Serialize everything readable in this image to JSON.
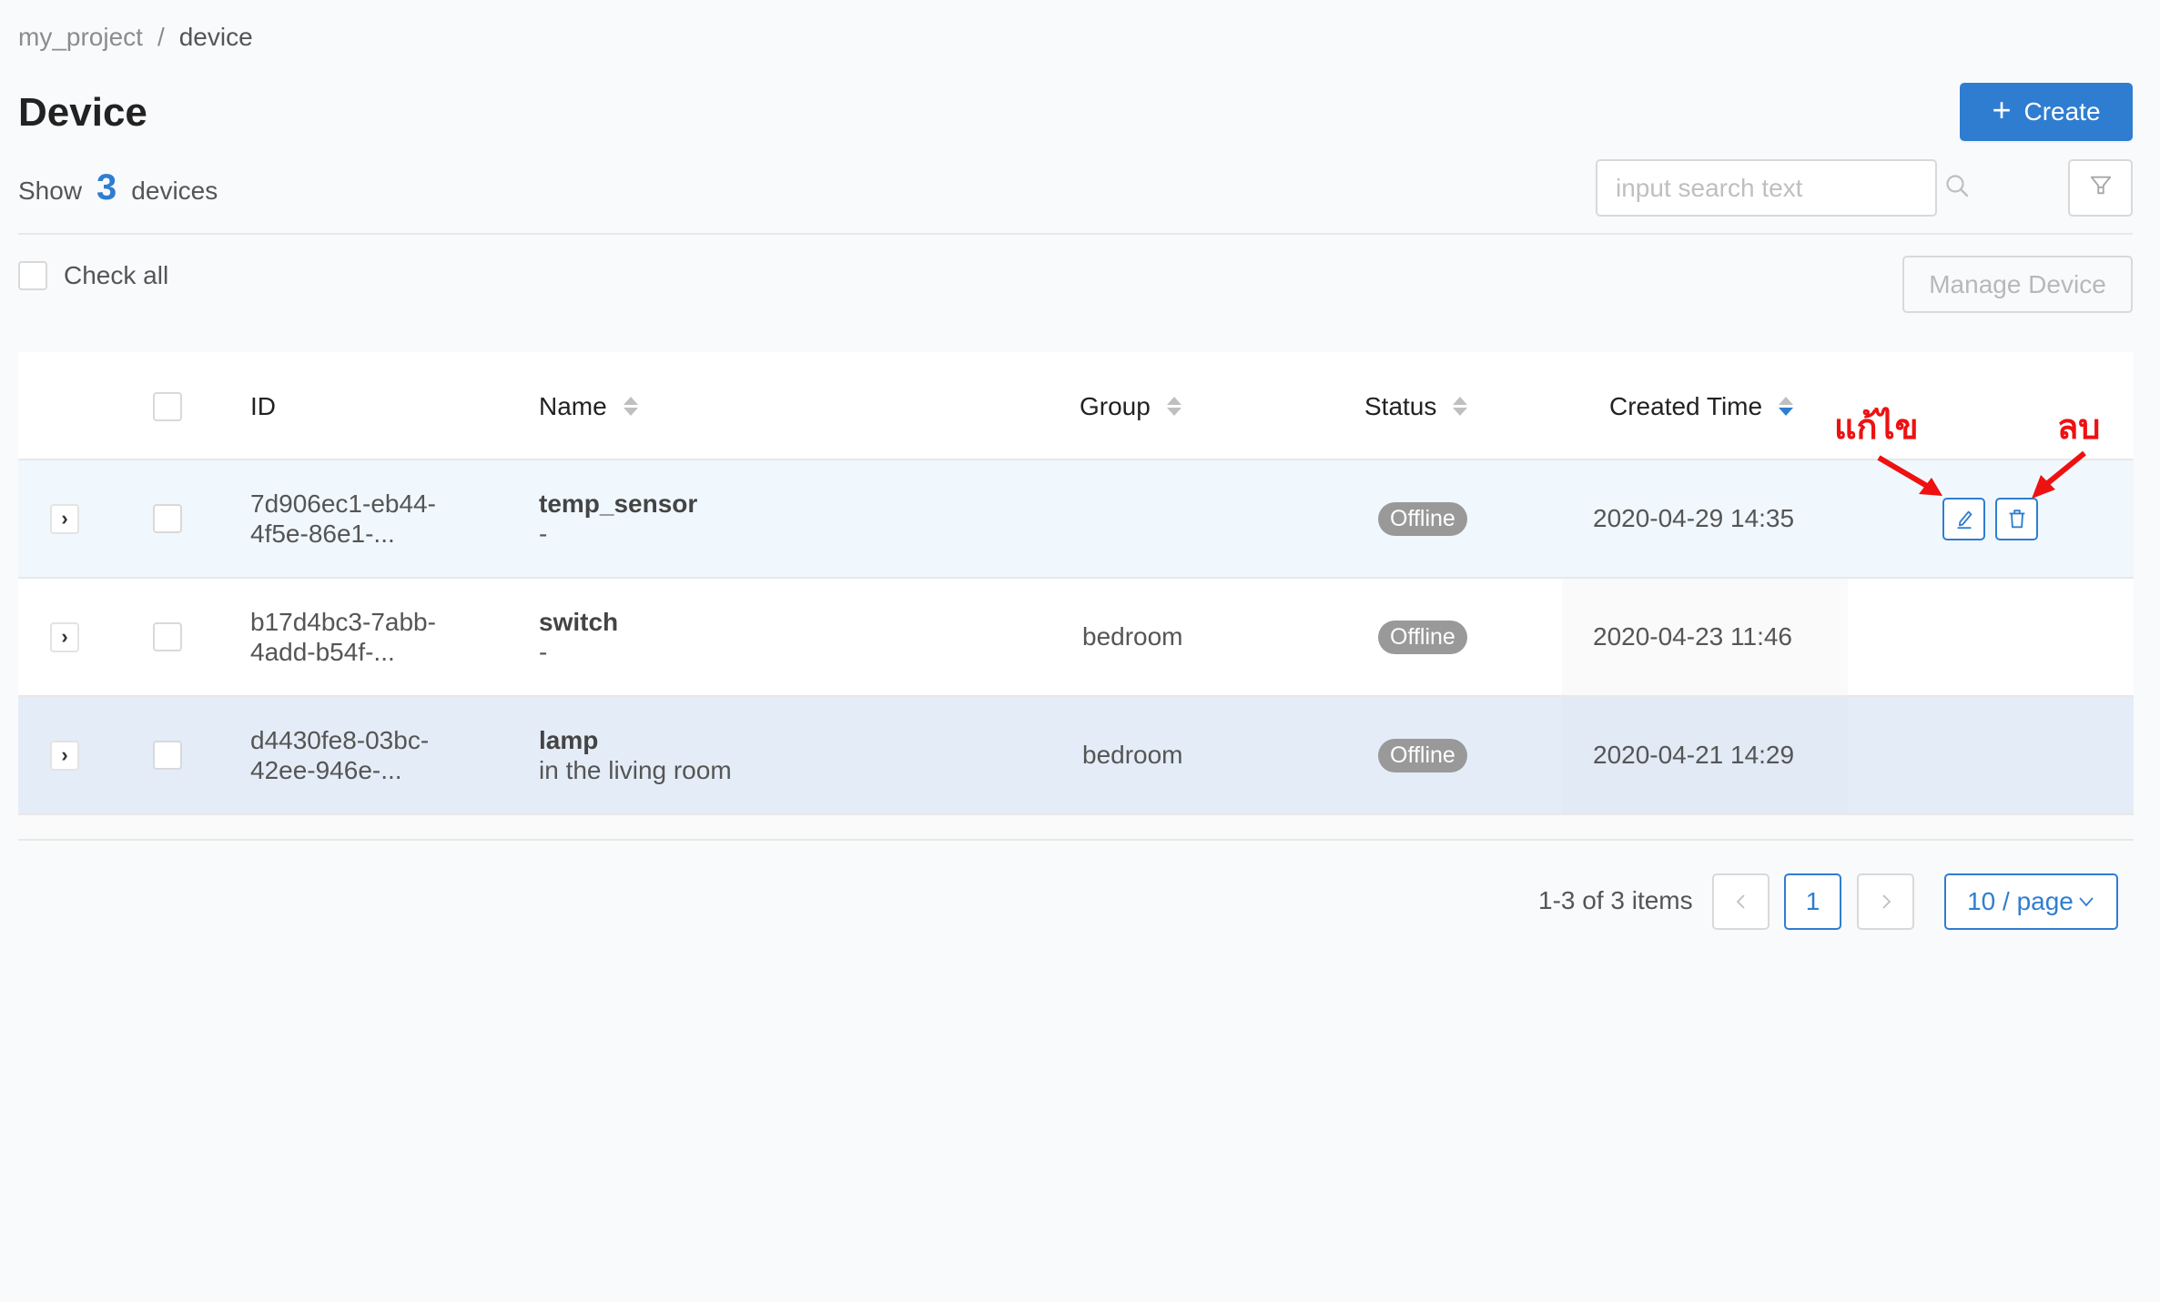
{
  "breadcrumb": {
    "root": "my_project",
    "separator": "/",
    "current": "device"
  },
  "page": {
    "title": "Device",
    "count_prefix": "Show",
    "count": "3",
    "count_suffix": "devices"
  },
  "toolbar": {
    "create_label": "Create",
    "create_icon": "plus-icon",
    "search_placeholder": "input search text",
    "search_value": "",
    "search_icon": "search-icon",
    "filter_icon": "filter-icon",
    "check_all_label": "Check all",
    "manage_label": "Manage Device"
  },
  "colors": {
    "accent": "#2f7dd1",
    "badge_offline": "#999999",
    "annotation": "#ee1111",
    "page_bg": "#f9fafc"
  },
  "table": {
    "columns": [
      {
        "key": "id",
        "label": "ID",
        "sortable": false
      },
      {
        "key": "name",
        "label": "Name",
        "sortable": true,
        "sort": "none"
      },
      {
        "key": "group",
        "label": "Group",
        "sortable": true,
        "sort": "none"
      },
      {
        "key": "status",
        "label": "Status",
        "sortable": true,
        "sort": "none"
      },
      {
        "key": "created",
        "label": "Created Time",
        "sortable": true,
        "sort": "descend"
      }
    ],
    "rows": [
      {
        "id": "7d906ec1-eb44-\n4f5e-86e1-...",
        "name": "temp_sensor",
        "description": "-",
        "group": "",
        "status": "Offline",
        "created": "2020-04-29 14:35",
        "show_actions": true
      },
      {
        "id": "b17d4bc3-7abb-\n4add-b54f-...",
        "name": "switch",
        "description": "-",
        "group": "bedroom",
        "status": "Offline",
        "created": "2020-04-23 11:46",
        "show_actions": false
      },
      {
        "id": "d4430fe8-03bc-\n42ee-946e-...",
        "name": "lamp",
        "description": "in the living room",
        "group": "bedroom",
        "status": "Offline",
        "created": "2020-04-21 14:29",
        "show_actions": false
      }
    ],
    "actions": {
      "edit_icon": "edit-icon",
      "delete_icon": "delete-icon"
    }
  },
  "pagination": {
    "total_text": "1-3 of 3 items",
    "current_page": "1",
    "page_size": "10 / page"
  },
  "annotations": {
    "edit_label": "แก้ไข",
    "delete_label": "ลบ"
  }
}
